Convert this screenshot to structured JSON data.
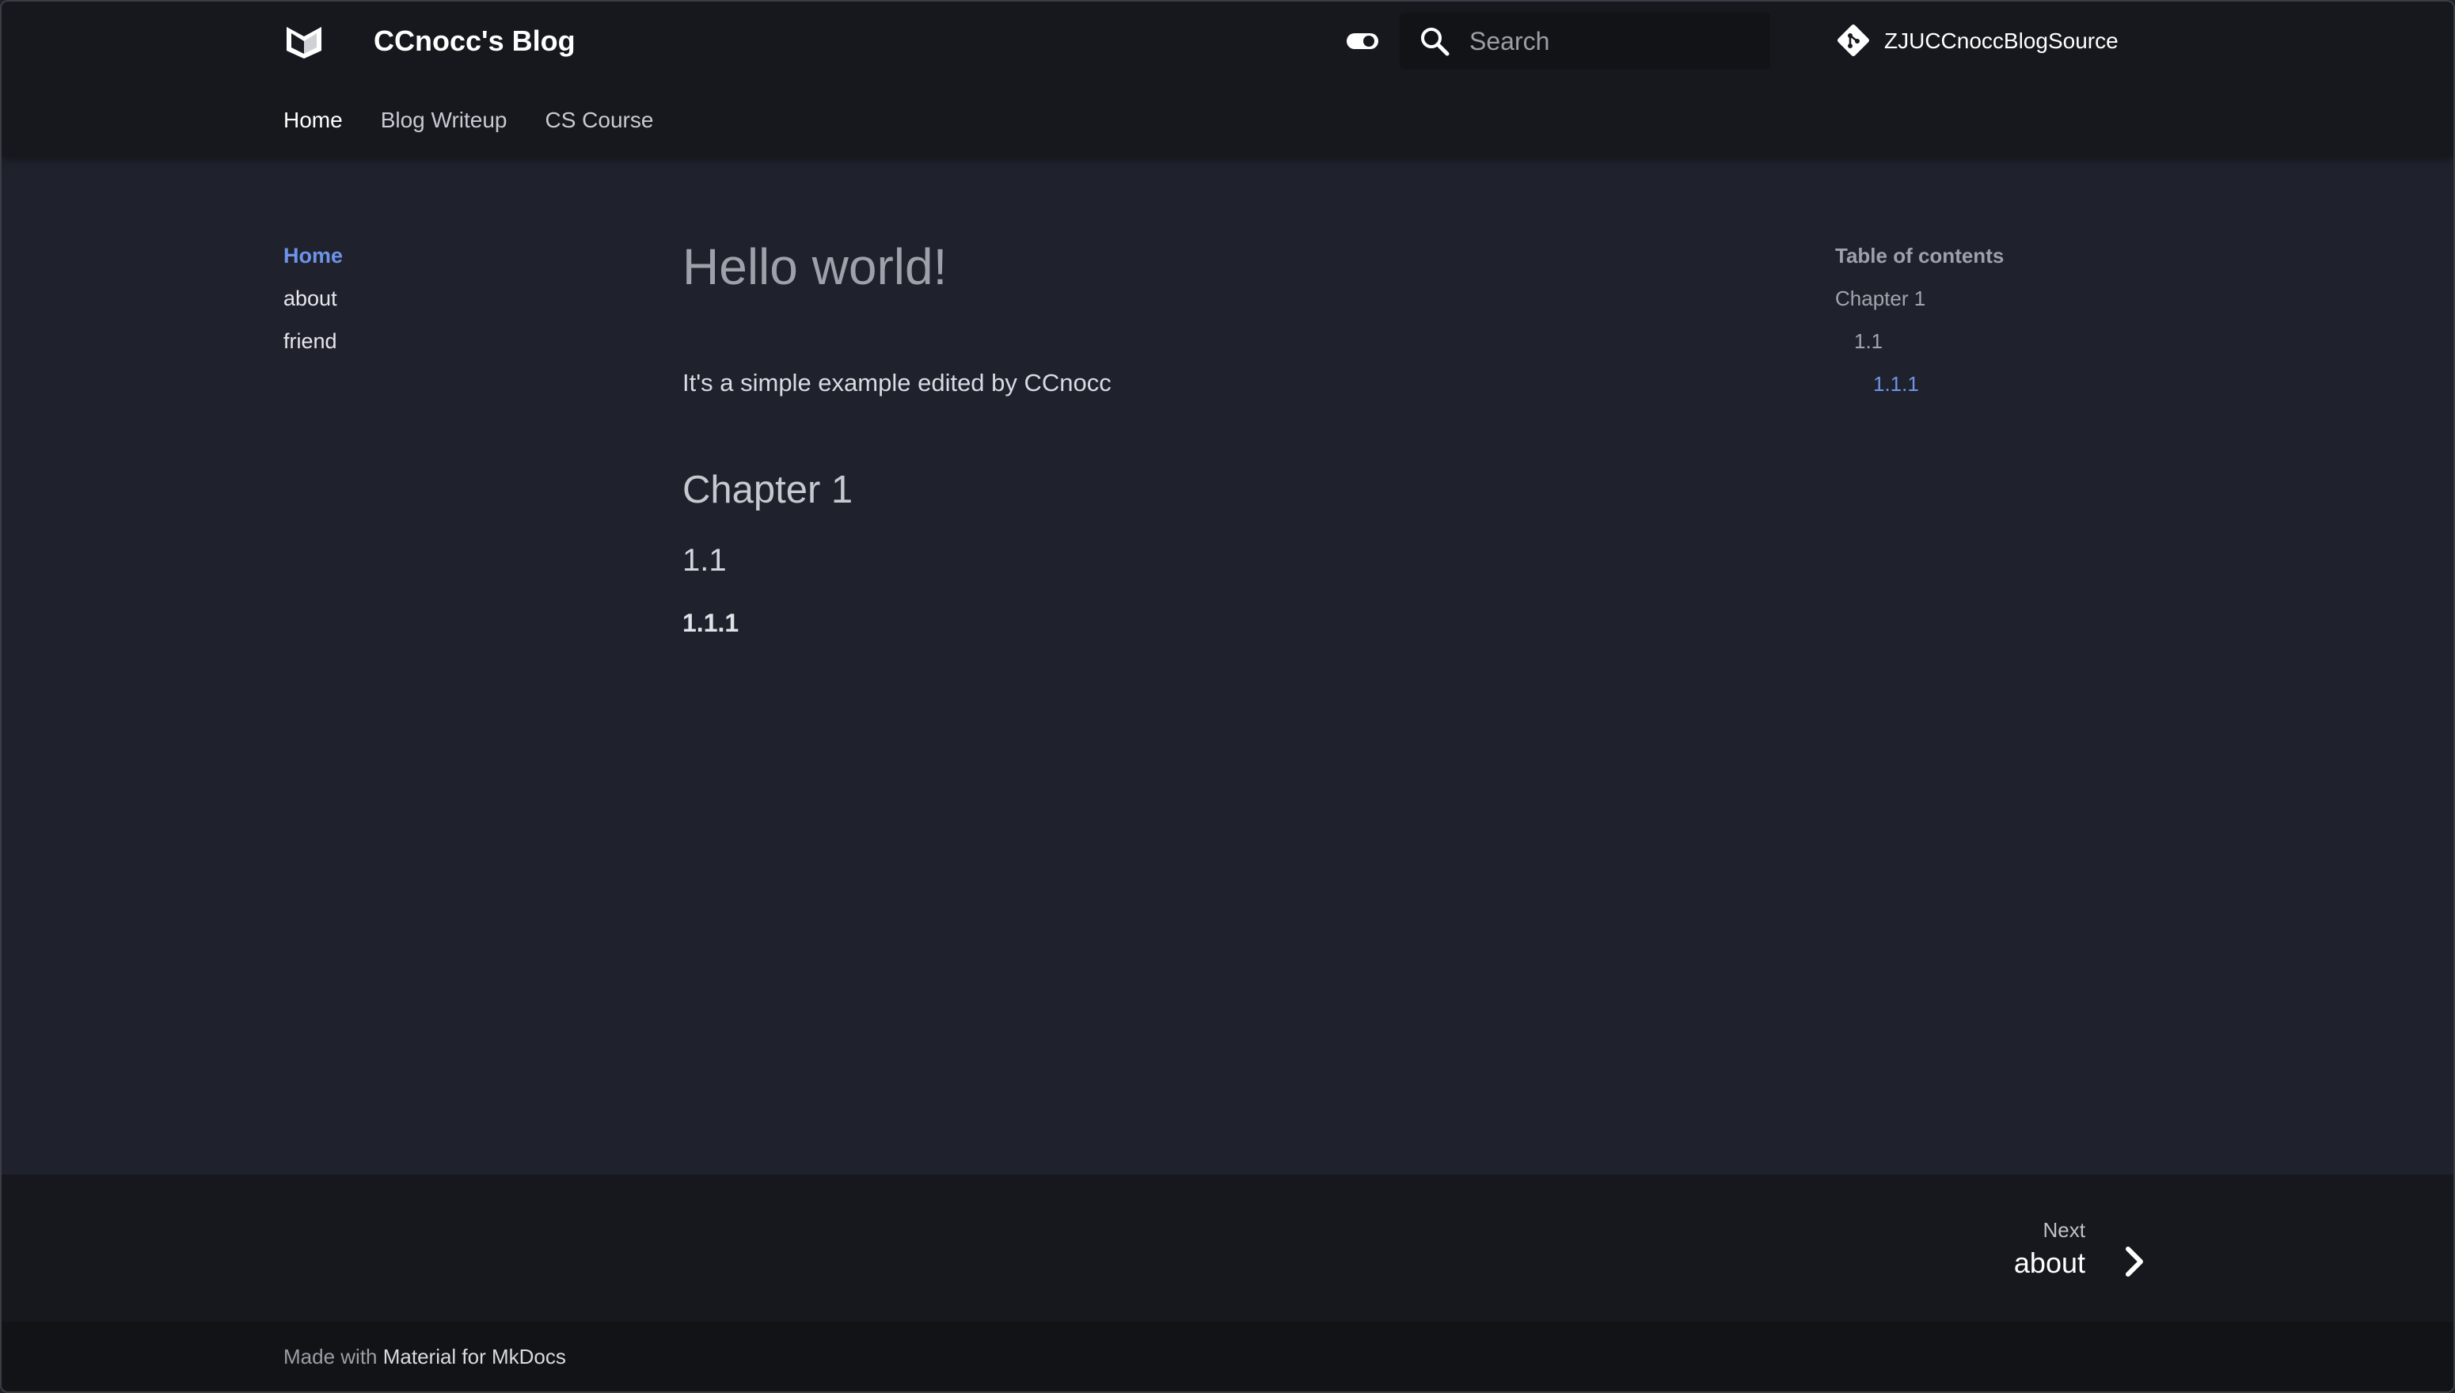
{
  "header": {
    "site_title": "CCnocc's Blog",
    "search_placeholder": "Search",
    "repo_name": "ZJUCCnoccBlogSource",
    "tabs": [
      {
        "label": "Home",
        "active": true
      },
      {
        "label": "Blog Writeup",
        "active": false
      },
      {
        "label": "CS Course",
        "active": false
      }
    ]
  },
  "sidebar": {
    "items": [
      {
        "label": "Home",
        "active": true
      },
      {
        "label": "about",
        "active": false
      },
      {
        "label": "friend",
        "active": false
      }
    ]
  },
  "main": {
    "title": "Hello world!",
    "paragraph": "It's a simple example edited by CCnocc",
    "h2": "Chapter 1",
    "h3": "1.1",
    "h4": "1.1.1"
  },
  "toc": {
    "title": "Table of contents",
    "items": [
      "Chapter 1",
      "1.1",
      "1.1.1"
    ]
  },
  "footer": {
    "next_caption": "Next",
    "next_title": "about",
    "made_with_prefix": "Made with",
    "made_with_link": "Material for MkDocs"
  },
  "colors": {
    "accent": "#6e93e8",
    "header_bg": "#17181d",
    "page_bg": "#1f222c"
  },
  "icons": {
    "logo": "material-logo-icon",
    "toggle": "dark-mode-toggle-icon",
    "search": "search-icon",
    "repo": "git-icon",
    "next": "chevron-right-icon"
  }
}
